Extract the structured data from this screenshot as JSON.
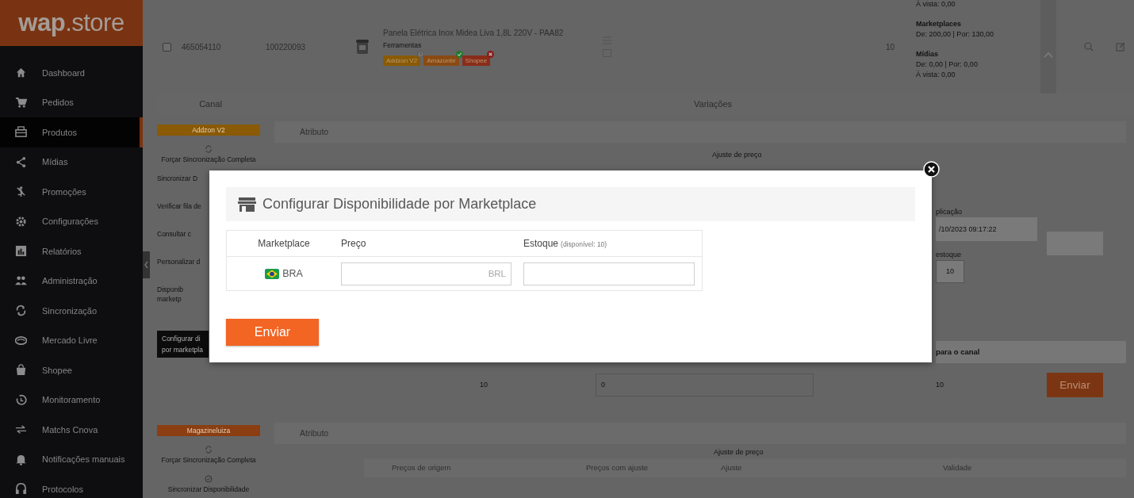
{
  "sidebar": {
    "logo": {
      "brand": "wap",
      "suffix": ".store"
    },
    "items": [
      {
        "label": "Dashboard",
        "selected": false
      },
      {
        "label": "Pedidos",
        "selected": false
      },
      {
        "label": "Produtos",
        "selected": true
      },
      {
        "label": "Mídias",
        "selected": false
      },
      {
        "label": "Promoções",
        "selected": false
      },
      {
        "label": "Configurações",
        "selected": false
      },
      {
        "label": "Relatórios",
        "selected": false
      },
      {
        "label": "Administração",
        "selected": false
      },
      {
        "label": "Sincronização",
        "selected": false
      },
      {
        "label": "Mercado Livre",
        "selected": false
      },
      {
        "label": "Shopee",
        "selected": false
      },
      {
        "label": "Monitoramento",
        "selected": false
      },
      {
        "label": "Matchs Cnova",
        "selected": false
      },
      {
        "label": "Notificações manuais",
        "selected": false
      },
      {
        "label": "Protocolos",
        "selected": false
      }
    ]
  },
  "product": {
    "checked": false,
    "id": "465054110",
    "sku": "100220093",
    "title": "Panela Elétrica Inox Midea Liva 1,8L 220V - PAA82",
    "category": "Ferramentas",
    "channels": [
      {
        "label": "Addzon V2",
        "color": "#8a5a06",
        "kind": "pending"
      },
      {
        "label": "Amazonbr",
        "color": "#8a4a14",
        "kind": "ok"
      },
      {
        "label": "Shopee",
        "color": "#8a2c1a",
        "kind": "error"
      }
    ],
    "stock": "10",
    "prices": [
      {
        "kind": "line",
        "text": "À vista: 0,00"
      },
      {
        "kind": "heading",
        "text": "Marketplaces"
      },
      {
        "kind": "line",
        "text": "De: 200,00 | Por: 130,00"
      },
      {
        "kind": "heading",
        "text": "Mídias"
      },
      {
        "kind": "line",
        "text": "De: 0,00 | Por: 0,00"
      },
      {
        "kind": "line",
        "text": "À vista: 0,00"
      }
    ]
  },
  "table_header": {
    "column_1": "Canal",
    "column_2": "Variações"
  },
  "section_1": {
    "channel": {
      "label": "Addzon V2",
      "color": "#8a5a06"
    },
    "actions": [
      "Forçar Sincronização Completa",
      "Sincronizar D",
      "Verificar fila de",
      "Consultar c",
      "Personalizar d",
      "Disponib",
      "marketp"
    ],
    "tooltip": [
      "Configurar di",
      "por marketpla"
    ],
    "attribute_label": "Atributo",
    "price_adjust_label": "Ajuste de preço",
    "application_label": "plicação",
    "application_value": "/10/2023 09:17:22",
    "stock_label": "estoque",
    "stock_value": "10",
    "channel_bar_label": "para o canal",
    "row": {
      "origin_stock": "10",
      "input_value": "0",
      "channel_stock": "10",
      "button": "Enviar"
    }
  },
  "section_2": {
    "channel": {
      "label": "Magazineluiza",
      "color": "#8a3e12"
    },
    "actions": [
      "Forçar Sincronização Completa",
      "Sincronizar Disponibilidade"
    ],
    "attribute_label": "Atributo",
    "price_adjust_label": "Ajuste de preço",
    "columns": [
      "Preços de origem",
      "Preços com ajuste",
      "Ajuste",
      "Validade"
    ]
  },
  "modal": {
    "title": "Configurar Disponibilidade por Marketplace",
    "columns": {
      "marketplace": "Marketplace",
      "price": "Preço",
      "stock": "Estoque",
      "stock_hint": "(disponível: 10)"
    },
    "rows": [
      {
        "marketplace": "BRA",
        "currency": "BRL"
      }
    ],
    "submit": "Enviar"
  }
}
